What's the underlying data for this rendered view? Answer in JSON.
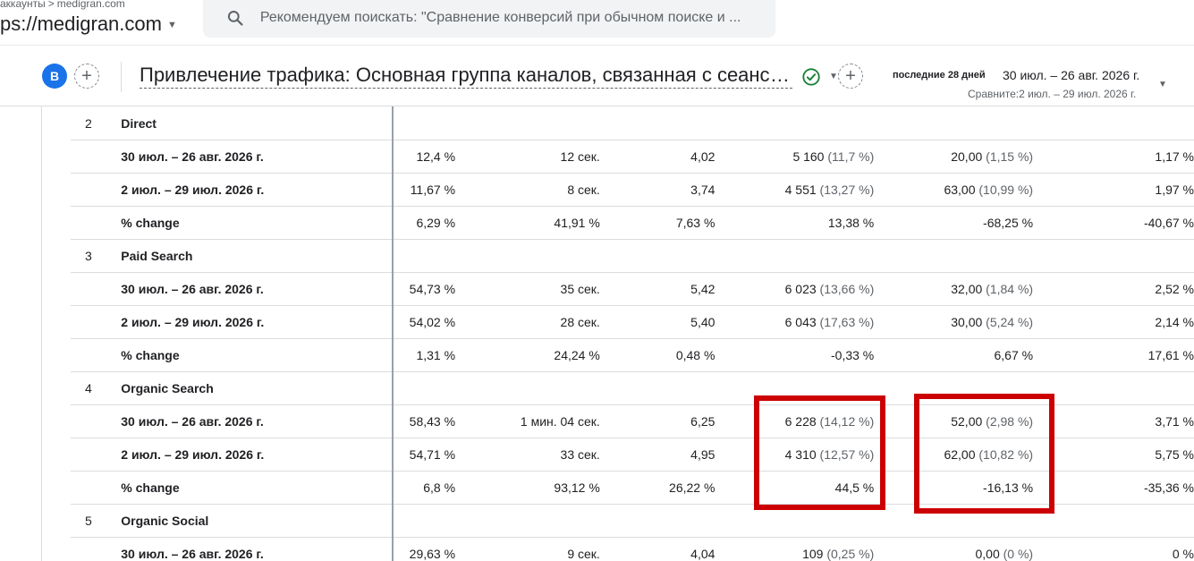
{
  "header": {
    "breadcrumb_parent": "аккаунты",
    "breadcrumb_sep": ">",
    "breadcrumb_child": "medigran.com",
    "property": "ps://medigran.com",
    "search_placeholder": "Рекомендуем поискать: \"Сравнение конверсий при обычном поиске и ..."
  },
  "report": {
    "avatar_letter": "B",
    "title": "Привлечение трафика: Основная группа каналов, связанная с сеансом",
    "date_label": "последние 28 дней",
    "date_range": "30 июл. – 26 авг. 2026 г.",
    "compare_range": "Сравните:2 июл. – 29 июл. 2026 г."
  },
  "table": {
    "groups": [
      {
        "index": "2",
        "name": "Direct",
        "rows": [
          {
            "label": "30 июл. – 26 авг. 2026 г.",
            "c1": "12,4 %",
            "c2": "12 сек.",
            "c3": "4,02",
            "c4": "5 160",
            "c4p": "(11,7 %)",
            "c5": "20,00",
            "c5p": "(1,15 %)",
            "c6": "1,17 %"
          },
          {
            "label": "2 июл. – 29 июл. 2026 г.",
            "c1": "11,67 %",
            "c2": "8 сек.",
            "c3": "3,74",
            "c4": "4 551",
            "c4p": "(13,27 %)",
            "c5": "63,00",
            "c5p": "(10,99 %)",
            "c6": "1,97 %"
          },
          {
            "label": "% change",
            "c1": "6,29 %",
            "c2": "41,91 %",
            "c3": "7,63 %",
            "c4": "13,38 %",
            "c4p": "",
            "c5": "-68,25 %",
            "c5p": "",
            "c6": "-40,67 %"
          }
        ]
      },
      {
        "index": "3",
        "name": "Paid Search",
        "rows": [
          {
            "label": "30 июл. – 26 авг. 2026 г.",
            "c1": "54,73 %",
            "c2": "35 сек.",
            "c3": "5,42",
            "c4": "6 023",
            "c4p": "(13,66 %)",
            "c5": "32,00",
            "c5p": "(1,84 %)",
            "c6": "2,52 %"
          },
          {
            "label": "2 июл. – 29 июл. 2026 г.",
            "c1": "54,02 %",
            "c2": "28 сек.",
            "c3": "5,40",
            "c4": "6 043",
            "c4p": "(17,63 %)",
            "c5": "30,00",
            "c5p": "(5,24 %)",
            "c6": "2,14 %"
          },
          {
            "label": "% change",
            "c1": "1,31 %",
            "c2": "24,24 %",
            "c3": "0,48 %",
            "c4": "-0,33 %",
            "c4p": "",
            "c5": "6,67 %",
            "c5p": "",
            "c6": "17,61 %"
          }
        ]
      },
      {
        "index": "4",
        "name": "Organic Search",
        "rows": [
          {
            "label": "30 июл. – 26 авг. 2026 г.",
            "c1": "58,43 %",
            "c2": "1 мин. 04 сек.",
            "c3": "6,25",
            "c4": "6 228",
            "c4p": "(14,12 %)",
            "c5": "52,00",
            "c5p": "(2,98 %)",
            "c6": "3,71 %"
          },
          {
            "label": "2 июл. – 29 июл. 2026 г.",
            "c1": "54,71 %",
            "c2": "33 сек.",
            "c3": "4,95",
            "c4": "4 310",
            "c4p": "(12,57 %)",
            "c5": "62,00",
            "c5p": "(10,82 %)",
            "c6": "5,75 %"
          },
          {
            "label": "% change",
            "c1": "6,8 %",
            "c2": "93,12 %",
            "c3": "26,22 %",
            "c4": "44,5 %",
            "c4p": "",
            "c5": "-16,13 %",
            "c5p": "",
            "c6": "-35,36 %"
          }
        ]
      },
      {
        "index": "5",
        "name": "Organic Social",
        "rows": [
          {
            "label": "30 июл. – 26 авг. 2026 г.",
            "c1": "29,63 %",
            "c2": "9 сек.",
            "c3": "4,04",
            "c4": "109",
            "c4p": "(0,25 %)",
            "c5": "0,00",
            "c5p": "(0 %)",
            "c6": "0 %"
          }
        ]
      }
    ]
  },
  "highlight_color": "#cc0000"
}
